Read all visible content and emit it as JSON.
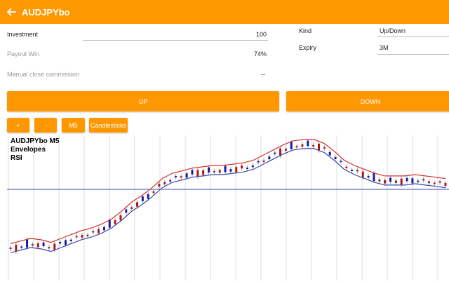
{
  "header": {
    "title": "AUDJPYbo",
    "back_icon": "arrow-left-icon"
  },
  "form": {
    "investment_label": "Investment",
    "investment_value": "100",
    "payout_label": "Payout Win",
    "payout_value": "74%",
    "commission_label": "Manual close commission",
    "commission_value": "--",
    "kind_label": "Kind",
    "kind_value": "Up/Down",
    "expiry_label": "Expiry",
    "expiry_value": "3M"
  },
  "actions": {
    "up_label": "UP",
    "down_label": "DOWN"
  },
  "toolbar": {
    "plus_label": "+",
    "minus_label": "-",
    "timeframe_label": "M5",
    "chart_type_label": "Candlesticks"
  },
  "chart": {
    "legend": [
      "AUDJPYbo M5",
      "Envelopes",
      "RSI"
    ],
    "colors": {
      "bull": "#1a1aa8",
      "bear": "#b01818",
      "envelope_upper": "#d32f2f",
      "envelope_lower": "#3949ab",
      "hline": "#3949ab",
      "grid": "#dcdcdc"
    }
  },
  "chart_data": {
    "type": "candlestick",
    "x_tick_labels": [],
    "y_tick_labels": [],
    "series": [
      {
        "values": [
          20,
          22,
          24,
          23,
          21,
          24,
          27,
          30,
          32,
          35,
          39,
          45,
          52,
          57,
          63,
          70,
          74,
          76,
          78,
          79,
          80,
          80,
          81,
          82,
          84,
          88,
          92,
          96,
          99,
          100,
          100,
          97,
          91,
          84,
          80,
          77,
          74,
          72,
          72,
          72,
          73,
          72,
          71,
          70
        ]
      },
      {
        "values": [
          24,
          26,
          28,
          27,
          25,
          28,
          31,
          34,
          36,
          39,
          43,
          49,
          56,
          61,
          67,
          74,
          78,
          80,
          82,
          83,
          84,
          84,
          85,
          86,
          88,
          92,
          96,
          100,
          103,
          104,
          104,
          101,
          95,
          88,
          84,
          81,
          78,
          76,
          76,
          76,
          77,
          76,
          75,
          74
        ]
      },
      {
        "values": [
          17,
          19,
          21,
          20,
          18,
          21,
          24,
          27,
          29,
          32,
          36,
          42,
          49,
          54,
          60,
          67,
          71,
          73,
          75,
          76,
          77,
          77,
          78,
          79,
          81,
          85,
          89,
          93,
          96,
          97,
          97,
          94,
          88,
          81,
          77,
          74,
          71,
          69,
          69,
          69,
          70,
          69,
          68,
          67
        ]
      }
    ]
  }
}
